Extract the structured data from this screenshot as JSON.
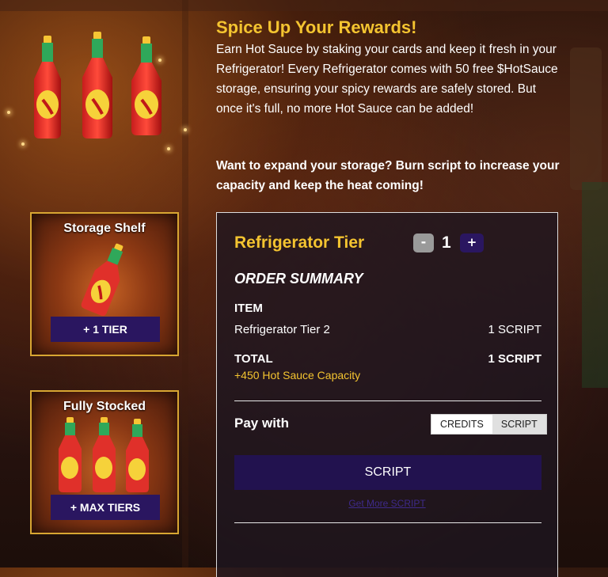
{
  "title": "Spice Up Your Rewards!",
  "description": "Earn Hot Sauce by staking your cards and keep it fresh in your Refrigerator! Every Refrigerator comes with 50 free $HotSauce storage, ensuring your spicy rewards are safely stored. But once it's full, no more Hot Sauce can be added!",
  "cta_text": "Want to expand your storage? Burn script to increase your capacity and keep the heat coming!",
  "cards": [
    {
      "title": "Storage Shelf",
      "button": "+ 1 TIER"
    },
    {
      "title": "Fully Stocked",
      "button": "+ MAX TIERS"
    }
  ],
  "panel": {
    "tier_title": "Refrigerator Tier",
    "stepper": {
      "minus": "-",
      "value": "1",
      "plus": "+"
    },
    "order_summary": "ORDER SUMMARY",
    "item_header": "ITEM",
    "item_name": "Refrigerator Tier 2",
    "item_price": "1 SCRIPT",
    "total_label": "TOTAL",
    "total_value": "1 SCRIPT",
    "capacity_note": "+450 Hot Sauce Capacity",
    "pay_with": "Pay with",
    "pay_options": [
      "CREDITS",
      "SCRIPT"
    ],
    "pay_button": "SCRIPT",
    "get_more_link": "Get More SCRIPT"
  },
  "colors": {
    "accent_yellow": "#f4c430",
    "button_purple": "#2a1660",
    "card_border": "#d8a632"
  }
}
